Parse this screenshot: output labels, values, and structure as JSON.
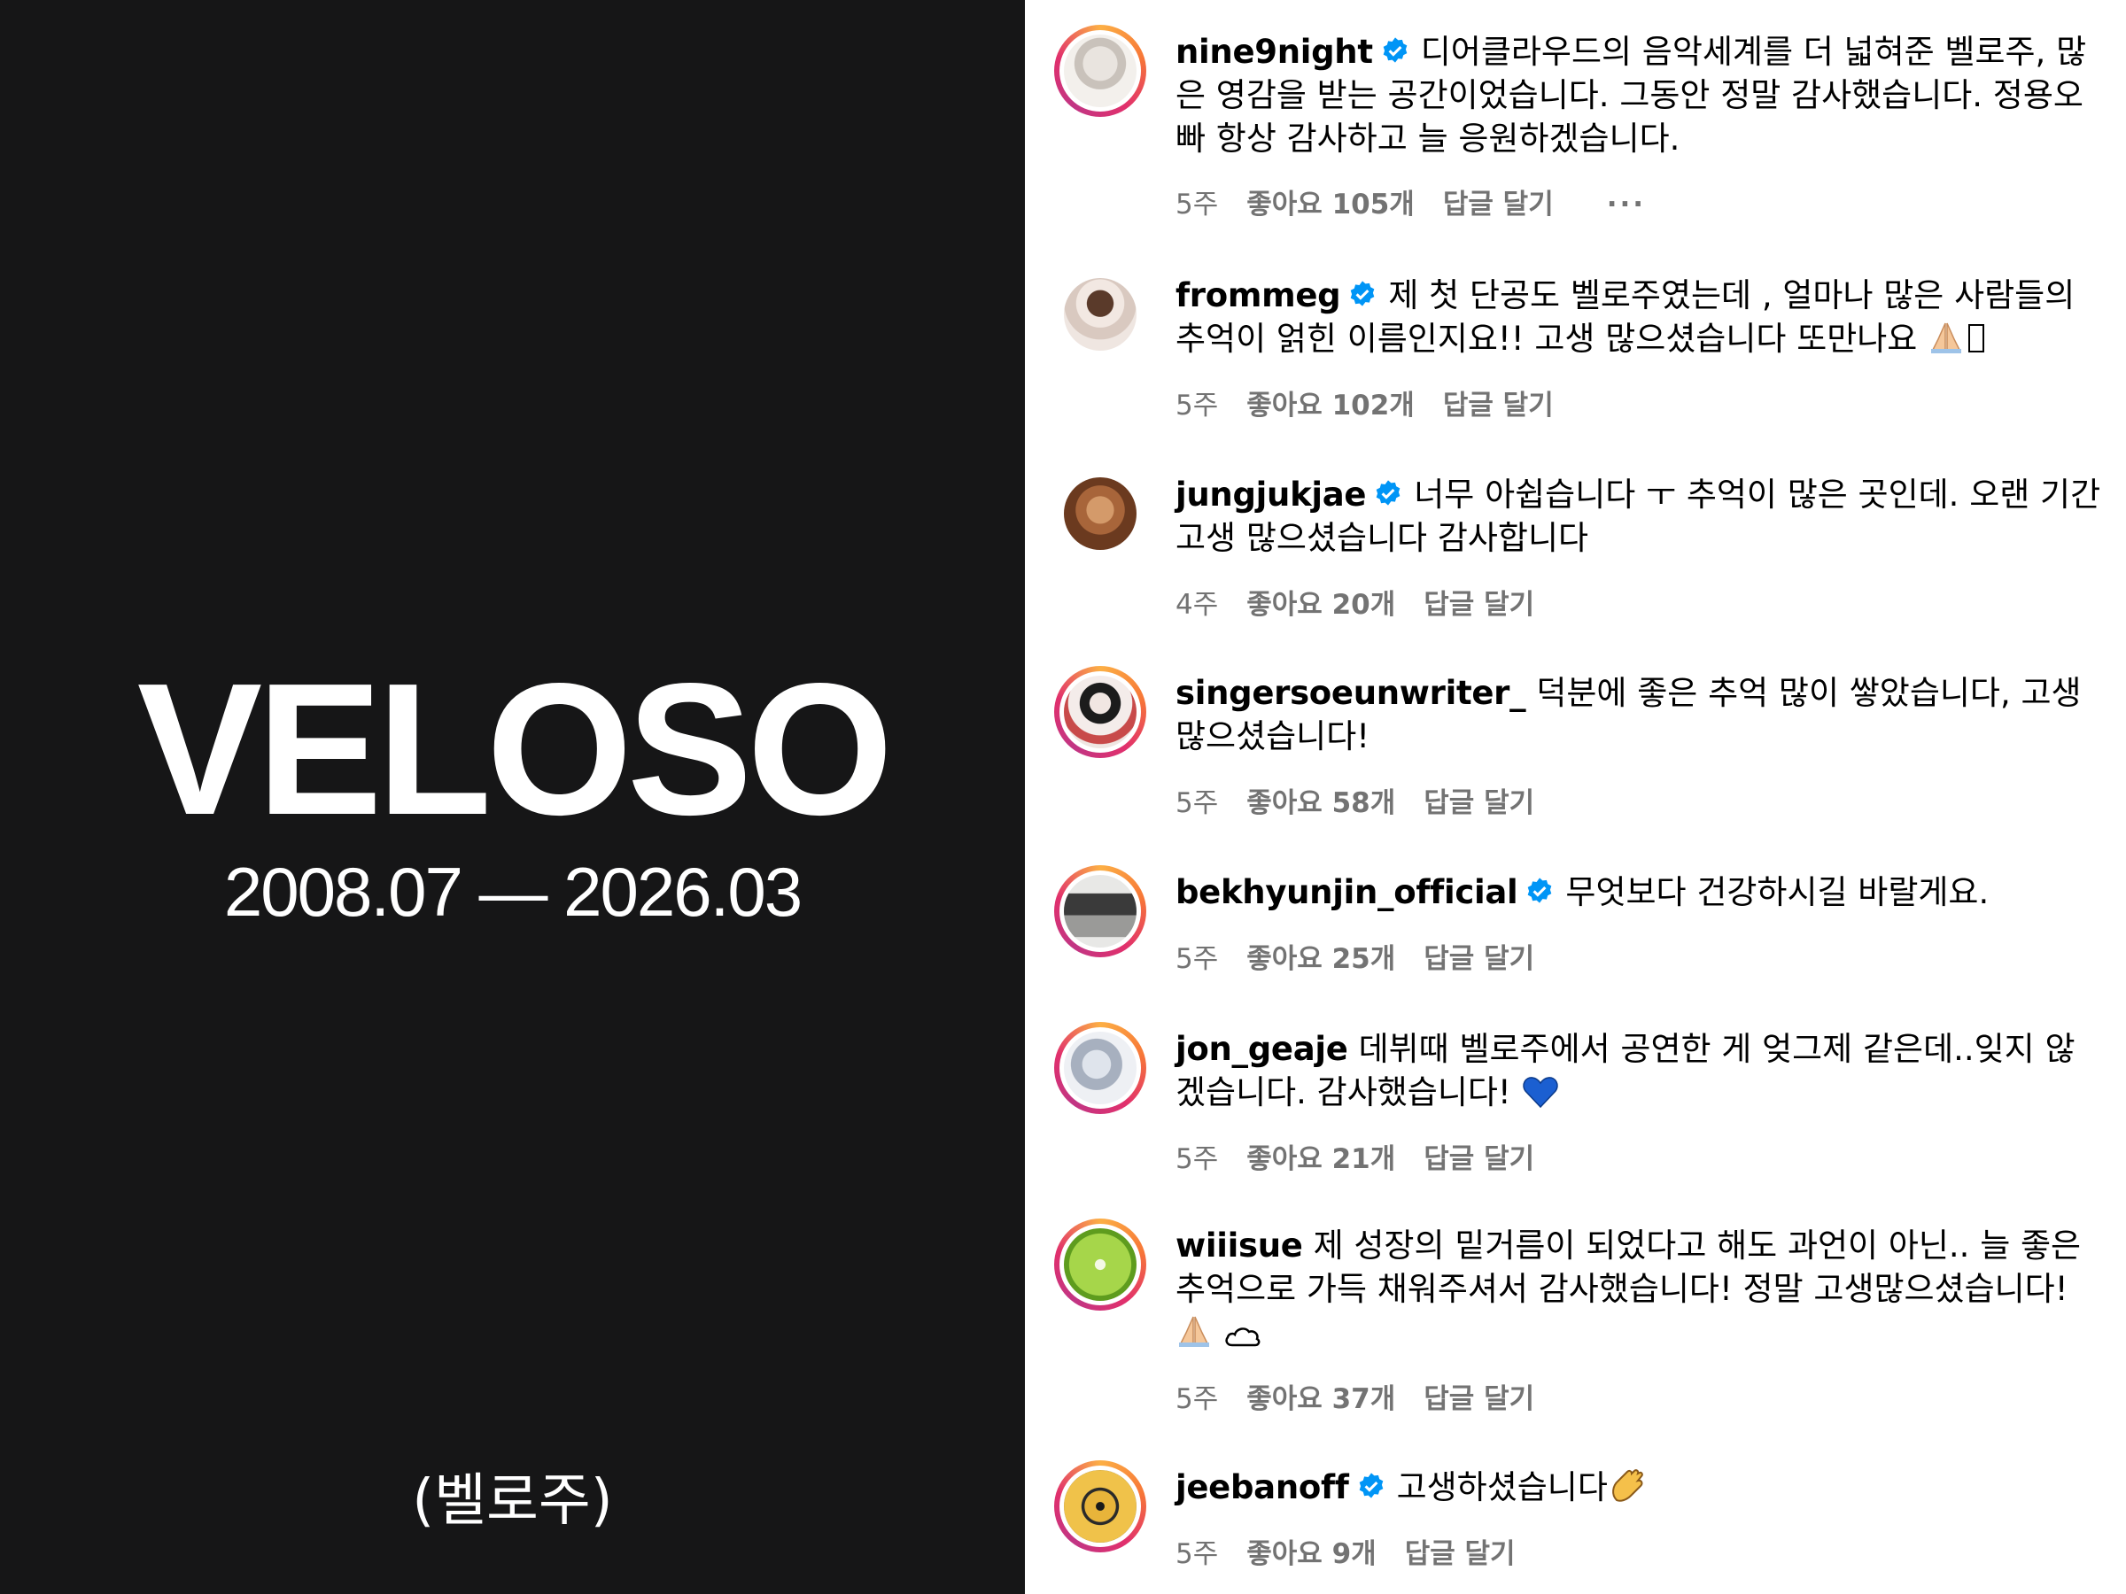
{
  "post": {
    "title": "VELOSO",
    "dates": "2008.07 — 2026.03",
    "caption": "(벨로주)"
  },
  "comments": [
    {
      "username": "nine9night",
      "verified": true,
      "text": "디어클라우드의 음악세계를 더 넓혀준 벨로주, 많은 영감을 받는 공간이었습니다. 그동안 정말 감사했습니다. 정용오빠 항상 감사하고 늘 응원하겠습니다.",
      "time": "5주",
      "likes": "좋아요 105개",
      "reply": "답글 달기",
      "more": "···"
    },
    {
      "username": "frommeg",
      "verified": true,
      "text": "제 첫 단공도 벨로주였는데 , 얼마나 많은 사람들의 추억이 얽힌 이름인지요!! 고생 많으셨습니다 또만나요",
      "time": "5주",
      "likes": "좋아요 102개",
      "reply": "답글 달기"
    },
    {
      "username": "jungjukjae",
      "verified": true,
      "text": "너무 아쉽습니다 ㅜ 추억이 많은 곳인데. 오랜 기간 고생 많으셨습니다 감사합니다",
      "time": "4주",
      "likes": "좋아요 20개",
      "reply": "답글 달기"
    },
    {
      "username": "singersoeunwriter_",
      "verified": false,
      "text": "덕분에 좋은 추억 많이 쌓았습니다, 고생 많으셨습니다!",
      "time": "5주",
      "likes": "좋아요 58개",
      "reply": "답글 달기"
    },
    {
      "username": "bekhyunjin_official",
      "verified": true,
      "text": "무엇보다 건강하시길 바랄게요.",
      "time": "5주",
      "likes": "좋아요 25개",
      "reply": "답글 달기"
    },
    {
      "username": "jon_geaje",
      "verified": false,
      "text": "데뷔때 벨로주에서 공연한 게 엊그제 같은데..잊지 않겠습니다. 감사했습니다!",
      "time": "5주",
      "likes": "좋아요 21개",
      "reply": "답글 달기"
    },
    {
      "username": "wiiisue",
      "verified": false,
      "text": "제 성장의 밑거름이 되었다고 해도 과언이 아닌.. 늘 좋은 추억으로 가득 채워주셔서 감사했습니다! 정말 고생많으셨습니다!",
      "time": "5주",
      "likes": "좋아요 37개",
      "reply": "답글 달기"
    },
    {
      "username": "jeebanoff",
      "verified": true,
      "text": "고생하셨습니다",
      "time": "5주",
      "likes": "좋아요 9개",
      "reply": "답글 달기"
    }
  ],
  "colors": {
    "post_bg": "#161617",
    "verified_blue": "#0095f6",
    "meta_gray": "#737373"
  },
  "icons": [
    "verified-badge-icon",
    "pray-emoji-icon",
    "heart-emoji-icon",
    "cloud-emoji-icon",
    "clap-emoji-icon",
    "more-options-icon"
  ]
}
